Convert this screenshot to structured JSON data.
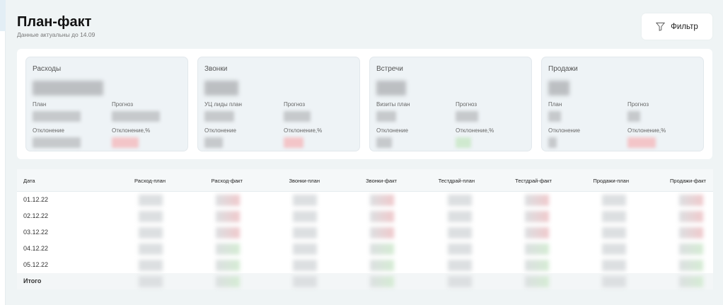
{
  "header": {
    "title": "План-факт",
    "subtitle": "Данные актуальны до 14.09",
    "filter_label": "Фильтр"
  },
  "cards": [
    {
      "title": "Расходы",
      "l1": "План",
      "l2": "Прогноз",
      "l3": "Отклонение",
      "l4": "Отклонение,%",
      "dev_status": "negative"
    },
    {
      "title": "Звонки",
      "l1": "УЦ лиды план",
      "l2": "Прогноз",
      "l3": "Отклонение",
      "l4": "Отклонение,%",
      "dev_status": "negative"
    },
    {
      "title": "Встречи",
      "l1": "Визиты план",
      "l2": "Прогноз",
      "l3": "Отклонение",
      "l4": "Отклонение,%",
      "dev_status": "positive"
    },
    {
      "title": "Продажи",
      "l1": "План",
      "l2": "Прогноз",
      "l3": "Отклонение",
      "l4": "Отклонение,%",
      "dev_status": "negative"
    }
  ],
  "table": {
    "columns": [
      "Дата",
      "Расход-план",
      "Расход-факт",
      "Звонки-план",
      "Звонки-факт",
      "Тестдрай-план",
      "Тестдрай-факт",
      "Продажи-план",
      "Продажи-факт"
    ],
    "rows": [
      "01.12.22",
      "02.12.22",
      "03.12.22",
      "04.12.22",
      "05.12.22"
    ],
    "total_label": "Итого"
  },
  "colors": {
    "negative": "#f3c5c8",
    "positive": "#cfe9cf"
  }
}
